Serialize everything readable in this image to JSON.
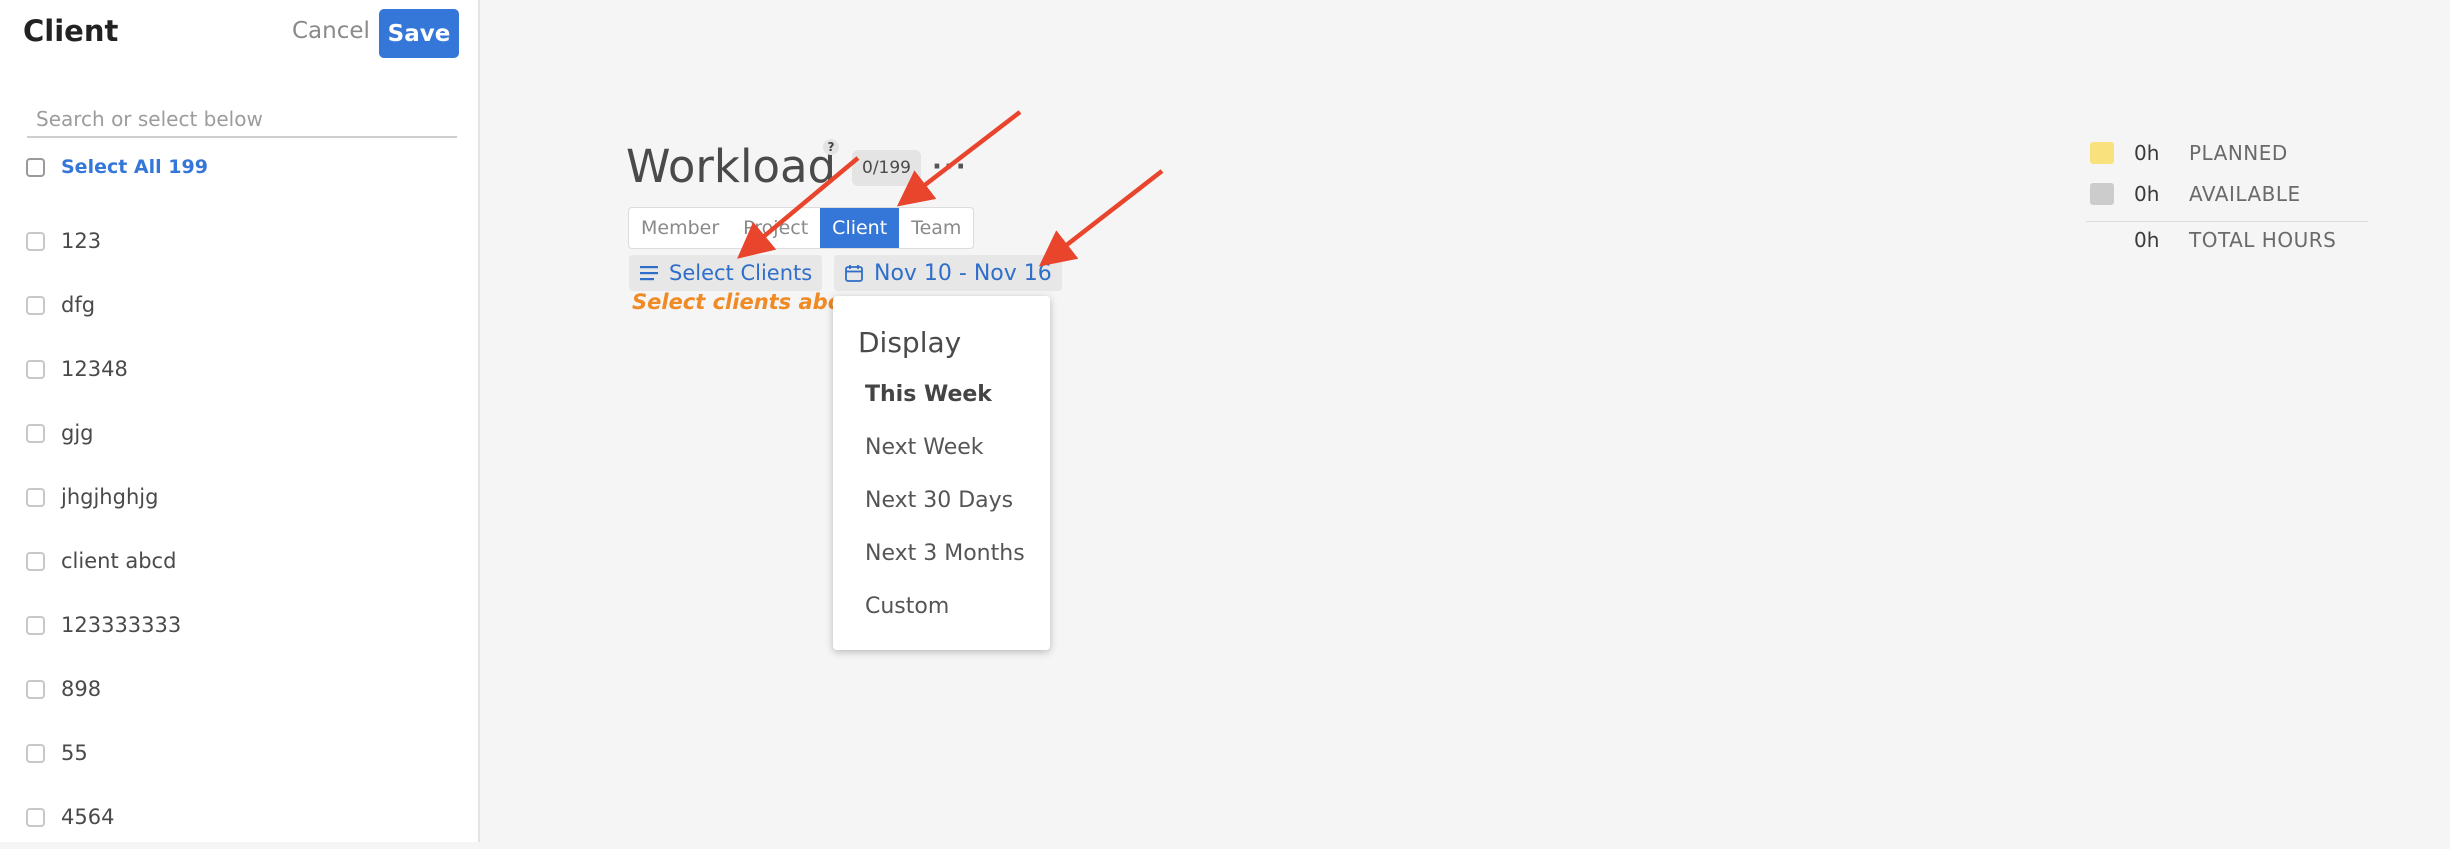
{
  "panel": {
    "title": "Client",
    "cancel_label": "Cancel",
    "save_label": "Save",
    "search_placeholder": "Search or select below",
    "select_all_label": "Select All 199",
    "clients": [
      "123",
      "dfg",
      "12348",
      "gjg",
      "jhgjhghjg",
      "client abcd",
      "123333333",
      "898",
      "55",
      "4564"
    ]
  },
  "main": {
    "title": "Workload",
    "help_label": "?",
    "count_badge": "0/199",
    "more_label": "···",
    "tabs": [
      "Member",
      "Project",
      "Client",
      "Team"
    ],
    "active_tab": "Client",
    "select_clients_label": "Select Clients",
    "select_clients_hint": "Select clients above",
    "date_range_label": "Nov 10 - Nov 16"
  },
  "dropdown": {
    "header": "Display",
    "items": [
      "This Week",
      "Next Week",
      "Next 30 Days",
      "Next 3 Months",
      "Custom"
    ],
    "selected": "This Week"
  },
  "legend": {
    "planned_hours": "0h",
    "planned_label": "PLANNED",
    "available_hours": "0h",
    "available_label": "AVAILABLE",
    "total_hours": "0h",
    "total_label": "TOTAL HOURS"
  },
  "colors": {
    "accent": "#3577d8",
    "hint": "#f08a24",
    "planned_swatch": "#f9e27d",
    "available_swatch": "#cccccc",
    "annotation_arrow": "#e8452c"
  }
}
